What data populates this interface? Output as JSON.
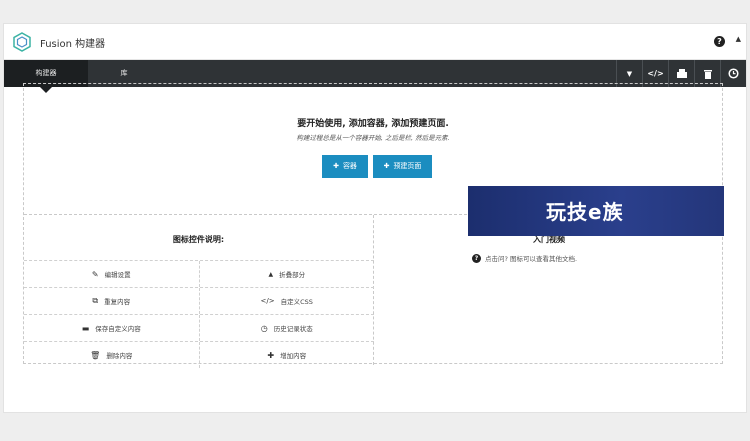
{
  "app": {
    "title": "Fusion 构建器"
  },
  "tabs": {
    "builder": "构建器",
    "library": "库"
  },
  "intro": {
    "title": "要开始使用, 添加容器, 添加预建页面.",
    "subtitle": "构建过程总是从一个容器开始, 之后是栏, 然后是元素."
  },
  "buttons": {
    "container": "容器",
    "prebuilt": "预建页面"
  },
  "legend": {
    "title": "图标控件说明:",
    "rows": [
      {
        "left": "编辑设置",
        "right": "折叠部分"
      },
      {
        "left": "重复内容",
        "right": "自定义CSS"
      },
      {
        "left": "保存自定义内容",
        "right": "历史记录状态"
      },
      {
        "left": "删除内容",
        "right": "增加内容"
      }
    ]
  },
  "video": {
    "title": "入门视频",
    "banner_text": "玩技e族",
    "note": "点击问? 图标可以查看其他文档."
  },
  "colors": {
    "toolbar_bg": "#2f3336",
    "accent": "#1b8dc0"
  }
}
